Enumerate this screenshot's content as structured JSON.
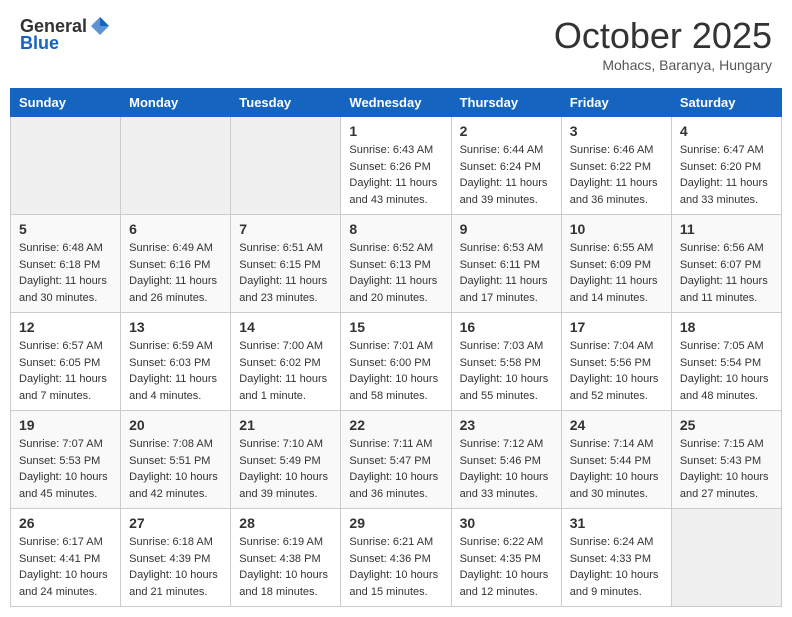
{
  "header": {
    "logo_general": "General",
    "logo_blue": "Blue",
    "month_title": "October 2025",
    "location": "Mohacs, Baranya, Hungary"
  },
  "days_of_week": [
    "Sunday",
    "Monday",
    "Tuesday",
    "Wednesday",
    "Thursday",
    "Friday",
    "Saturday"
  ],
  "weeks": [
    [
      {
        "day": "",
        "info": ""
      },
      {
        "day": "",
        "info": ""
      },
      {
        "day": "",
        "info": ""
      },
      {
        "day": "1",
        "info": "Sunrise: 6:43 AM\nSunset: 6:26 PM\nDaylight: 11 hours\nand 43 minutes."
      },
      {
        "day": "2",
        "info": "Sunrise: 6:44 AM\nSunset: 6:24 PM\nDaylight: 11 hours\nand 39 minutes."
      },
      {
        "day": "3",
        "info": "Sunrise: 6:46 AM\nSunset: 6:22 PM\nDaylight: 11 hours\nand 36 minutes."
      },
      {
        "day": "4",
        "info": "Sunrise: 6:47 AM\nSunset: 6:20 PM\nDaylight: 11 hours\nand 33 minutes."
      }
    ],
    [
      {
        "day": "5",
        "info": "Sunrise: 6:48 AM\nSunset: 6:18 PM\nDaylight: 11 hours\nand 30 minutes."
      },
      {
        "day": "6",
        "info": "Sunrise: 6:49 AM\nSunset: 6:16 PM\nDaylight: 11 hours\nand 26 minutes."
      },
      {
        "day": "7",
        "info": "Sunrise: 6:51 AM\nSunset: 6:15 PM\nDaylight: 11 hours\nand 23 minutes."
      },
      {
        "day": "8",
        "info": "Sunrise: 6:52 AM\nSunset: 6:13 PM\nDaylight: 11 hours\nand 20 minutes."
      },
      {
        "day": "9",
        "info": "Sunrise: 6:53 AM\nSunset: 6:11 PM\nDaylight: 11 hours\nand 17 minutes."
      },
      {
        "day": "10",
        "info": "Sunrise: 6:55 AM\nSunset: 6:09 PM\nDaylight: 11 hours\nand 14 minutes."
      },
      {
        "day": "11",
        "info": "Sunrise: 6:56 AM\nSunset: 6:07 PM\nDaylight: 11 hours\nand 11 minutes."
      }
    ],
    [
      {
        "day": "12",
        "info": "Sunrise: 6:57 AM\nSunset: 6:05 PM\nDaylight: 11 hours\nand 7 minutes."
      },
      {
        "day": "13",
        "info": "Sunrise: 6:59 AM\nSunset: 6:03 PM\nDaylight: 11 hours\nand 4 minutes."
      },
      {
        "day": "14",
        "info": "Sunrise: 7:00 AM\nSunset: 6:02 PM\nDaylight: 11 hours\nand 1 minute."
      },
      {
        "day": "15",
        "info": "Sunrise: 7:01 AM\nSunset: 6:00 PM\nDaylight: 10 hours\nand 58 minutes."
      },
      {
        "day": "16",
        "info": "Sunrise: 7:03 AM\nSunset: 5:58 PM\nDaylight: 10 hours\nand 55 minutes."
      },
      {
        "day": "17",
        "info": "Sunrise: 7:04 AM\nSunset: 5:56 PM\nDaylight: 10 hours\nand 52 minutes."
      },
      {
        "day": "18",
        "info": "Sunrise: 7:05 AM\nSunset: 5:54 PM\nDaylight: 10 hours\nand 48 minutes."
      }
    ],
    [
      {
        "day": "19",
        "info": "Sunrise: 7:07 AM\nSunset: 5:53 PM\nDaylight: 10 hours\nand 45 minutes."
      },
      {
        "day": "20",
        "info": "Sunrise: 7:08 AM\nSunset: 5:51 PM\nDaylight: 10 hours\nand 42 minutes."
      },
      {
        "day": "21",
        "info": "Sunrise: 7:10 AM\nSunset: 5:49 PM\nDaylight: 10 hours\nand 39 minutes."
      },
      {
        "day": "22",
        "info": "Sunrise: 7:11 AM\nSunset: 5:47 PM\nDaylight: 10 hours\nand 36 minutes."
      },
      {
        "day": "23",
        "info": "Sunrise: 7:12 AM\nSunset: 5:46 PM\nDaylight: 10 hours\nand 33 minutes."
      },
      {
        "day": "24",
        "info": "Sunrise: 7:14 AM\nSunset: 5:44 PM\nDaylight: 10 hours\nand 30 minutes."
      },
      {
        "day": "25",
        "info": "Sunrise: 7:15 AM\nSunset: 5:43 PM\nDaylight: 10 hours\nand 27 minutes."
      }
    ],
    [
      {
        "day": "26",
        "info": "Sunrise: 6:17 AM\nSunset: 4:41 PM\nDaylight: 10 hours\nand 24 minutes."
      },
      {
        "day": "27",
        "info": "Sunrise: 6:18 AM\nSunset: 4:39 PM\nDaylight: 10 hours\nand 21 minutes."
      },
      {
        "day": "28",
        "info": "Sunrise: 6:19 AM\nSunset: 4:38 PM\nDaylight: 10 hours\nand 18 minutes."
      },
      {
        "day": "29",
        "info": "Sunrise: 6:21 AM\nSunset: 4:36 PM\nDaylight: 10 hours\nand 15 minutes."
      },
      {
        "day": "30",
        "info": "Sunrise: 6:22 AM\nSunset: 4:35 PM\nDaylight: 10 hours\nand 12 minutes."
      },
      {
        "day": "31",
        "info": "Sunrise: 6:24 AM\nSunset: 4:33 PM\nDaylight: 10 hours\nand 9 minutes."
      },
      {
        "day": "",
        "info": ""
      }
    ]
  ]
}
